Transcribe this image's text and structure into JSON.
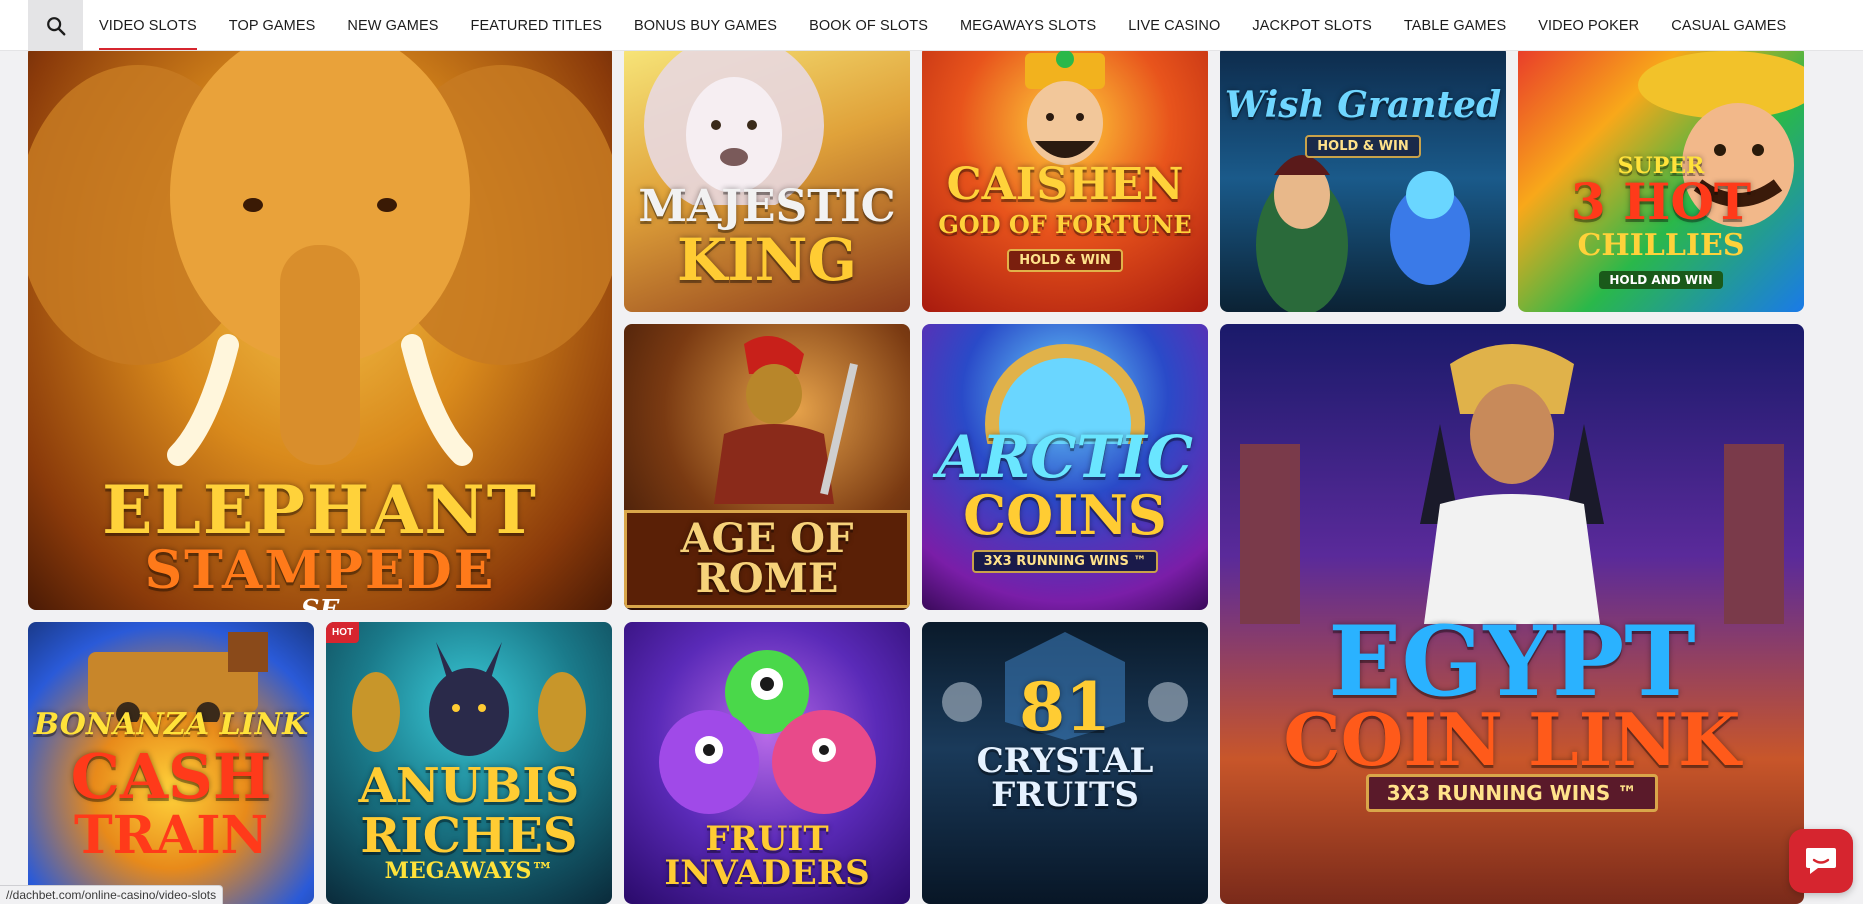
{
  "nav": {
    "search_icon": "search-icon",
    "items": [
      {
        "label": "VIDEO SLOTS",
        "active": true
      },
      {
        "label": "TOP GAMES"
      },
      {
        "label": "NEW GAMES"
      },
      {
        "label": "FEATURED TITLES"
      },
      {
        "label": "BONUS BUY GAMES"
      },
      {
        "label": "BOOK OF SLOTS"
      },
      {
        "label": "MEGAWAYS SLOTS"
      },
      {
        "label": "LIVE CASINO"
      },
      {
        "label": "JACKPOT SLOTS"
      },
      {
        "label": "TABLE GAMES"
      },
      {
        "label": "VIDEO POKER"
      },
      {
        "label": "CASUAL GAMES"
      }
    ],
    "active_color": "#d6252f"
  },
  "games": {
    "elephant": {
      "l1": "ELEPHANT",
      "l2": "STAMPEDE",
      "l3": "SE"
    },
    "lion": {
      "l1": "MAJESTIC",
      "l2": "KING"
    },
    "caishen": {
      "l1": "CAISHEN",
      "l2": "GOD OF FORTUNE",
      "tag": "HOLD & WIN"
    },
    "wish": {
      "l1": "Wish Granted",
      "tag": "HOLD & WIN"
    },
    "chillies": {
      "l1": "SUPER",
      "l2": "3 HOT",
      "l3": "CHILLIES",
      "tag": "HOLD AND WIN"
    },
    "rome": {
      "l1": "AGE OF ROME"
    },
    "arctic": {
      "l1": "ARCTIC",
      "l2": "COINS",
      "tag": "3X3 RUNNING WINS ™"
    },
    "egypt": {
      "l1": "EGYPT",
      "l2": "COIN LINK",
      "tag": "3X3 RUNNING WINS ™"
    },
    "cashtrain": {
      "l1": "BONANZA LINK",
      "l2": "CASH",
      "l3": "TRAIN"
    },
    "anubis": {
      "l1": "ANUBIS",
      "l2": "RICHES",
      "l3": "MEGAWAYS™",
      "badge": "HOT"
    },
    "invaders": {
      "l1": "FRUIT INVADERS"
    },
    "crystal": {
      "l1": "81",
      "l2": "CRYSTAL FRUITS"
    }
  },
  "status_url": "//dachbet.com/online-casino/video-slots",
  "chat": {
    "icon": "chat-icon",
    "color": "#d6252f"
  }
}
